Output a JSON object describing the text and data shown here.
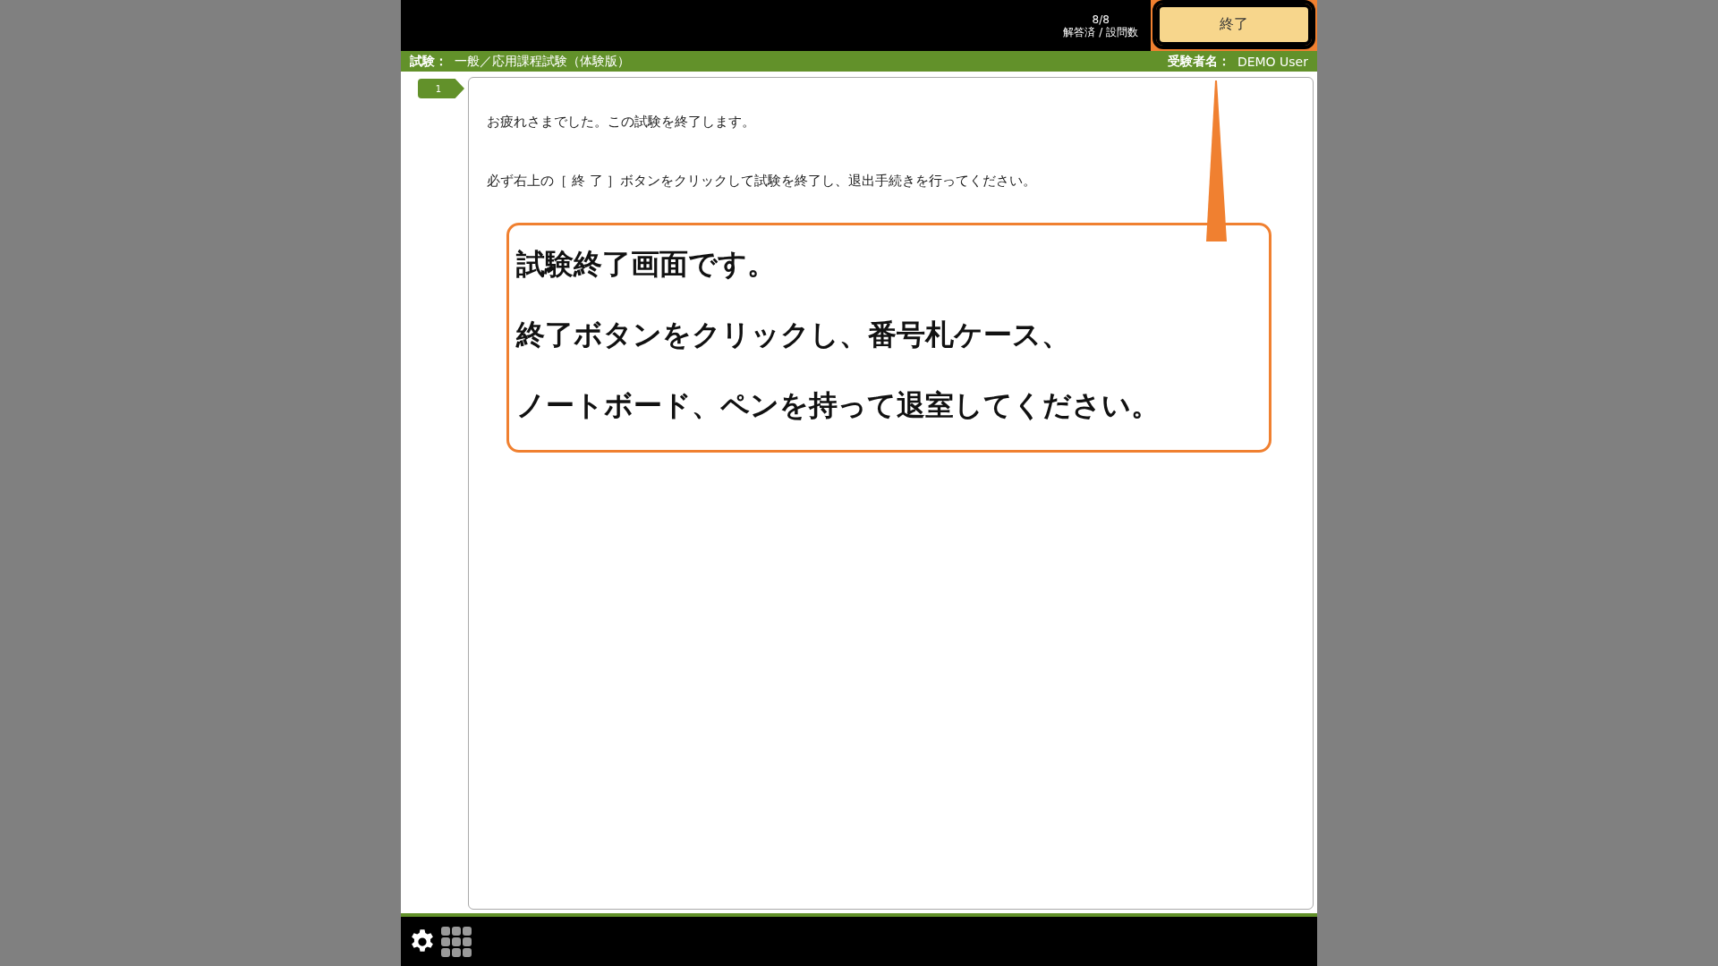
{
  "top_bar": {
    "progress": "8/8",
    "progress_label": "解答済 / 設問数",
    "end_button": "終了"
  },
  "exam_bar": {
    "exam_label": "試験：",
    "exam_name": "一般／応用課程試験（体験版）",
    "examinee_label": "受験者名：",
    "examinee_name": "DEMO User"
  },
  "question_tabs": [
    {
      "label": "1",
      "selected": true
    }
  ],
  "paragraphs": [
    "お疲れさまでした。この試験を終了します。",
    "必ず右上の［ 終 了 ］ボタンをクリックして試験を終了し、退出手続きを行ってください。"
  ],
  "callout": {
    "lines": [
      "試験終了画面です。",
      "終了ボタンをクリックし、番号札ケース、",
      "ノートボード、ペンを持って退室してください。"
    ]
  }
}
